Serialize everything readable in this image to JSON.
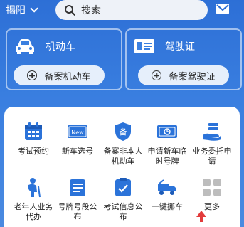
{
  "header": {
    "city": "揭阳",
    "search_label": "搜索"
  },
  "cards": [
    {
      "title": "机动车",
      "button": "备案机动车"
    },
    {
      "title": "驾驶证",
      "button": "备案驾驶证"
    }
  ],
  "services": [
    {
      "label": "考试预约",
      "icon": "calendar-icon"
    },
    {
      "label": "新车选号",
      "icon": "new-plate-icon"
    },
    {
      "label": "备案非本人机动车",
      "icon": "shield-badge-icon"
    },
    {
      "label": "申请新车临时号牌",
      "icon": "temp-plate-icon"
    },
    {
      "label": "业务委托申请",
      "icon": "hand-docs-icon"
    },
    {
      "label": "老年人业务代办",
      "icon": "elderly-icon"
    },
    {
      "label": "号牌号段公布",
      "icon": "plate-list-icon"
    },
    {
      "label": "考试信息公布",
      "icon": "exam-info-icon"
    },
    {
      "label": "一键挪车",
      "icon": "tow-truck-icon"
    },
    {
      "label": "更多",
      "icon": "more-grid-icon"
    }
  ],
  "colors": {
    "brand_blue": "#2d6fd6",
    "icon_blue": "#2b73d9",
    "accent_red": "#e23b3b"
  }
}
